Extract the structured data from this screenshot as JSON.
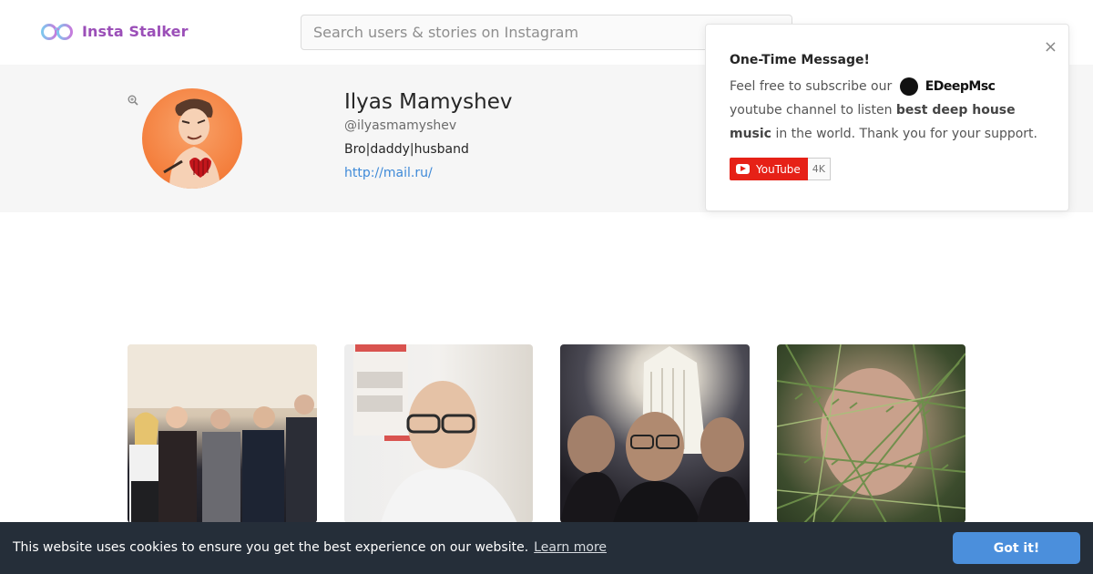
{
  "header": {
    "brand": "Insta Stalker",
    "search_placeholder": "Search users & stories on Instagram"
  },
  "profile": {
    "name": "Ilyas Mamyshev",
    "handle": "@ilyasmamyshev",
    "bio": "Bro|daddy|husband",
    "link": "http://mail.ru/"
  },
  "popup": {
    "title": "One-Time Message!",
    "text_before": "Feel free to subscribe our",
    "brand": "EDeepMsc",
    "text_after_brand": "youtube channel to listen",
    "bold": "best deep house music",
    "text_end": "in the world. Thank you for your support.",
    "close": "×",
    "youtube_label": "YouTube",
    "youtube_count": "4K"
  },
  "photos": [
    {
      "icon": "group-photo"
    },
    {
      "icon": "selfie-photo"
    },
    {
      "icon": "night-building-photo"
    },
    {
      "icon": "pine-branch-photo"
    }
  ],
  "cookie": {
    "message": "This website uses cookies to ensure you get the best experience on our website.",
    "learn_more": "Learn more",
    "button": "Got it!"
  },
  "colors": {
    "brand": "#9b4fb8",
    "link": "#3f8ad8",
    "cookie_bg": "#252e39",
    "cookie_button": "#4b8fdc",
    "youtube_red": "#e62117"
  }
}
